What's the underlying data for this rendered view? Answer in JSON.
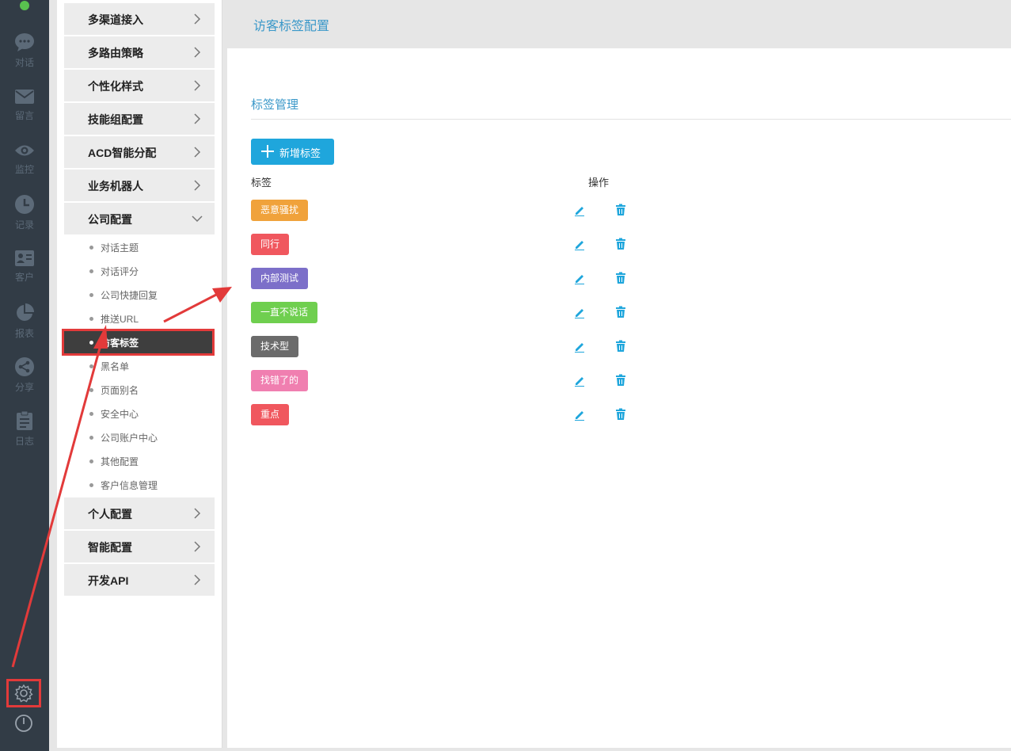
{
  "rail": {
    "items": [
      {
        "label": "对话",
        "icon": "chat-icon"
      },
      {
        "label": "留言",
        "icon": "mail-icon"
      },
      {
        "label": "监控",
        "icon": "eye-icon"
      },
      {
        "label": "记录",
        "icon": "clock-icon"
      },
      {
        "label": "客户",
        "icon": "contact-card-icon"
      },
      {
        "label": "报表",
        "icon": "pie-chart-icon"
      },
      {
        "label": "分享",
        "icon": "share-icon"
      },
      {
        "label": "日志",
        "icon": "clipboard-icon"
      }
    ],
    "bottom": [
      "settings-gear-icon",
      "power-icon"
    ]
  },
  "subnav": {
    "groups_top": [
      "多渠道接入",
      "多路由策略",
      "个性化样式",
      "技能组配置",
      "ACD智能分配",
      "业务机器人",
      "公司配置"
    ],
    "company_items": [
      "对话主题",
      "对话评分",
      "公司快捷回复",
      "推送URL",
      "访客标签",
      "黑名单",
      "页面别名",
      "安全中心",
      "公司账户中心",
      "其他配置",
      "客户信息管理"
    ],
    "active_item": "访客标签",
    "groups_bottom": [
      "个人配置",
      "智能配置",
      "开发API"
    ]
  },
  "header": {
    "title": "访客标签配置"
  },
  "main": {
    "section_title": "标签管理",
    "add_button": "新增标签",
    "columns": {
      "tag": "标签",
      "actions": "操作"
    },
    "tags": [
      {
        "name": "恶意骚扰",
        "color": "#f0a23b"
      },
      {
        "name": "同行",
        "color": "#f0575e"
      },
      {
        "name": "内部测试",
        "color": "#7c6fc9"
      },
      {
        "name": "一直不说话",
        "color": "#6fcf4f"
      },
      {
        "name": "技术型",
        "color": "#6b6b6b"
      },
      {
        "name": "找错了的",
        "color": "#f07fb0"
      },
      {
        "name": "重点",
        "color": "#f0575e"
      }
    ]
  },
  "colors": {
    "accent": "#1fa6dc",
    "title_blue": "#3a98c9",
    "annotation_red": "#e23a3a"
  }
}
